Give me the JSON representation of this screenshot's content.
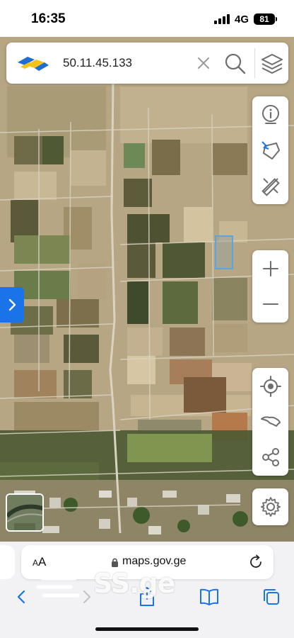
{
  "status_bar": {
    "time": "16:35",
    "network": "4G",
    "battery": "81"
  },
  "search": {
    "query": "50.11.45.133"
  },
  "map_tools": {
    "info": "info-icon",
    "measure_area": "measure-area-icon",
    "draw": "ruler-pencil-icon",
    "zoom_in": "+",
    "zoom_out": "−",
    "locate": "locate-icon",
    "country": "georgia-map-icon",
    "share": "share-icon",
    "settings": "gear-icon"
  },
  "browser": {
    "aa_label_small": "A",
    "aa_label_large": "A",
    "url": "maps.gov.ge"
  },
  "watermark": {
    "text": "SS.ge"
  },
  "colors": {
    "accent": "#1a73e8",
    "parcel": "#5aa7e0"
  }
}
